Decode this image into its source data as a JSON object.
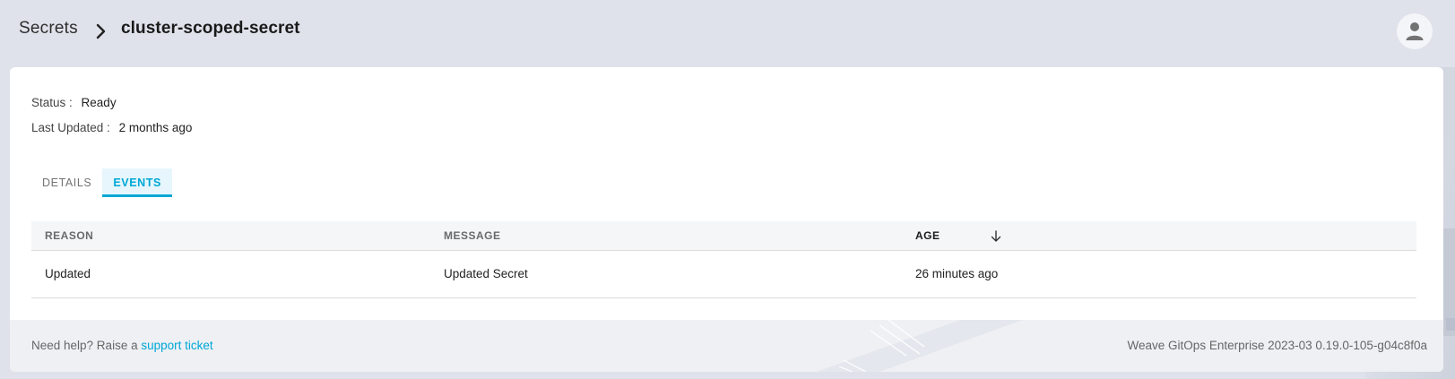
{
  "breadcrumb": {
    "parent": "Secrets",
    "current": "cluster-scoped-secret"
  },
  "user": {
    "icon": "person-icon"
  },
  "info": {
    "status_label": "Status :",
    "status_value": "Ready",
    "updated_label": "Last Updated :",
    "updated_value": "2 months ago"
  },
  "tabs": [
    {
      "label": "DETAILS",
      "active": false
    },
    {
      "label": "EVENTS",
      "active": true
    }
  ],
  "events_table": {
    "columns": [
      "REASON",
      "MESSAGE",
      "AGE"
    ],
    "sort_column": "AGE",
    "sort_direction": "descending",
    "rows": [
      {
        "reason": "Updated",
        "message": "Updated Secret",
        "age": "26 minutes ago"
      }
    ]
  },
  "footer": {
    "help_prefix": "Need help? Raise a",
    "help_link": "support ticket",
    "version": "Weave GitOps Enterprise 2023-03 0.19.0-105-g04c8f0a"
  },
  "colors": {
    "accent": "#00a7d6",
    "background": "#dfe2ea",
    "card": "#ffffff"
  }
}
